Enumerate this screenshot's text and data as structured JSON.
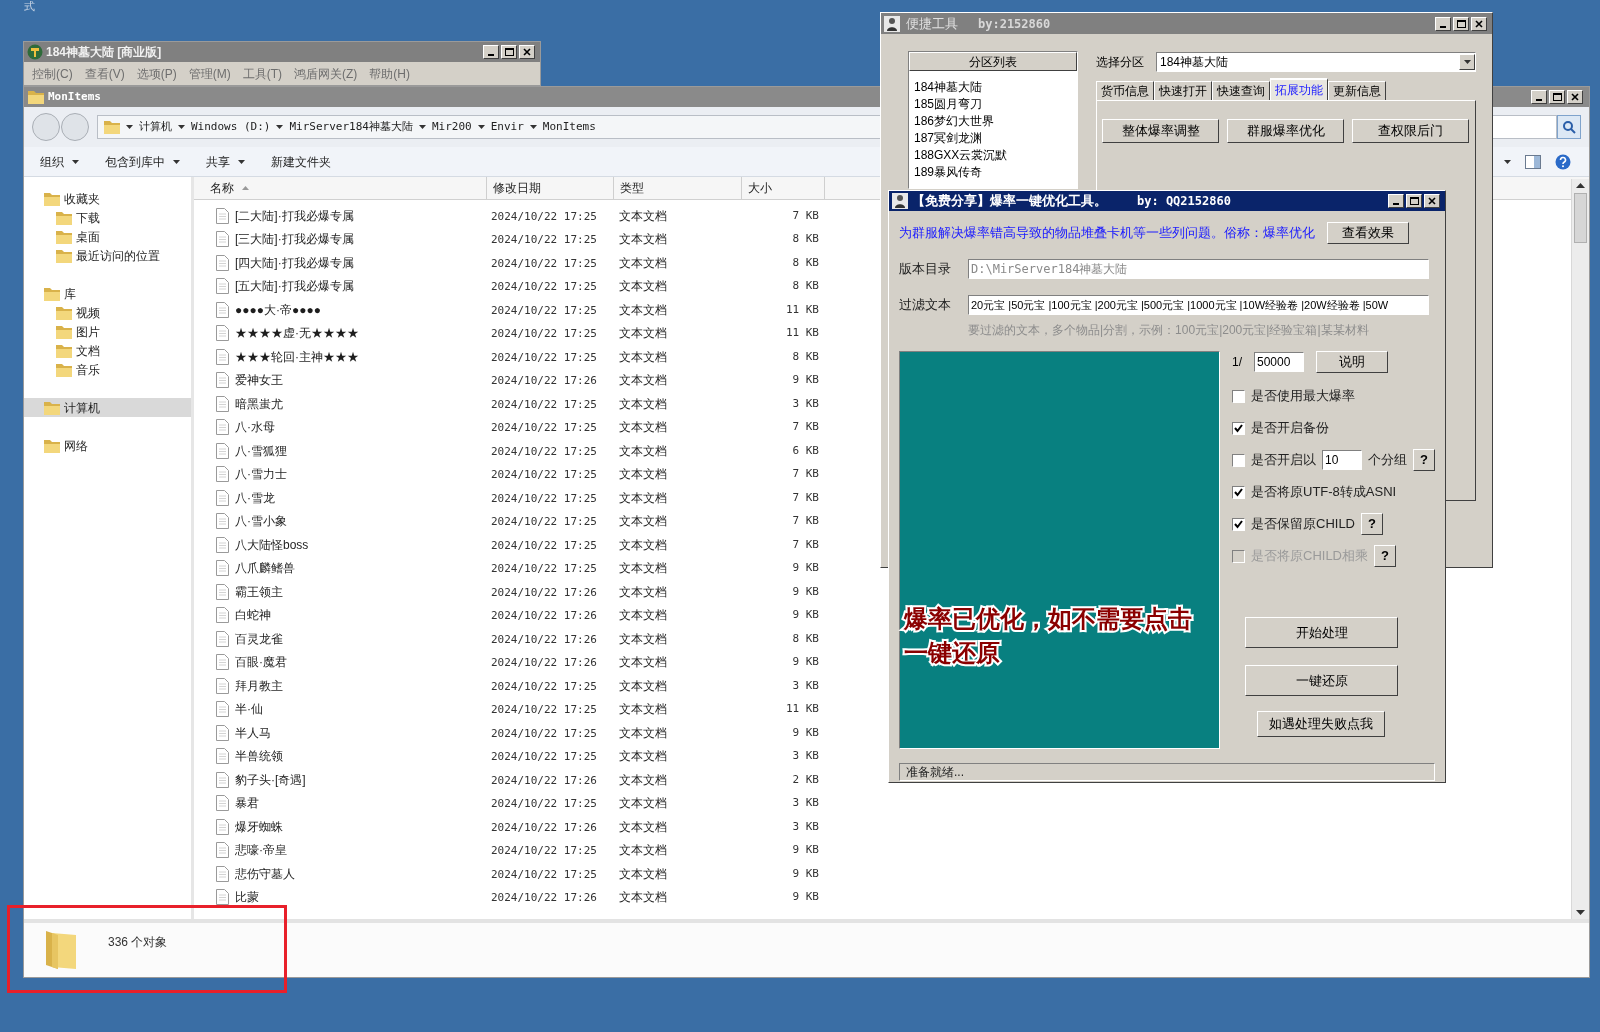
{
  "desktop": {
    "corner_text": "式"
  },
  "app_window": {
    "title": "184神墓大陆 [商业版]",
    "menu": [
      "控制(C)",
      "查看(V)",
      "选项(P)",
      "管理(M)",
      "工具(T)",
      "鸿盾网关(Z)",
      "帮助(H)"
    ]
  },
  "explorer": {
    "title": "MonItems",
    "breadcrumb": [
      "计算机",
      "Windows (D:)",
      "MirServer184神墓大陆",
      "Mir200",
      "Envir",
      "MonItems"
    ],
    "toolbar": [
      {
        "label": "组织",
        "dropdown": true
      },
      {
        "label": "包含到库中",
        "dropdown": true
      },
      {
        "label": "共享",
        "dropdown": true
      },
      {
        "label": "新建文件夹",
        "dropdown": false
      }
    ],
    "nav": [
      {
        "label": "收藏夹",
        "selected": false,
        "children": [
          {
            "label": "下载",
            "selected": false
          },
          {
            "label": "桌面",
            "selected": false
          },
          {
            "label": "最近访问的位置",
            "selected": false
          }
        ]
      },
      {
        "label": "库",
        "selected": false,
        "children": [
          {
            "label": "视频",
            "selected": false
          },
          {
            "label": "图片",
            "selected": false
          },
          {
            "label": "文档",
            "selected": false
          },
          {
            "label": "音乐",
            "selected": false
          }
        ]
      },
      {
        "label": "计算机",
        "selected": true
      },
      {
        "label": "网络",
        "selected": false
      }
    ],
    "columns": [
      "名称",
      "修改日期",
      "类型",
      "大小"
    ],
    "rows": [
      {
        "name": "[二大陆]·打我必爆专属",
        "date": "2024/10/22 17:25",
        "type": "文本文档",
        "size": "7 KB"
      },
      {
        "name": "[三大陆]·打我必爆专属",
        "date": "2024/10/22 17:25",
        "type": "文本文档",
        "size": "8 KB"
      },
      {
        "name": "[四大陆]·打我必爆专属",
        "date": "2024/10/22 17:25",
        "type": "文本文档",
        "size": "8 KB"
      },
      {
        "name": "[五大陆]·打我必爆专属",
        "date": "2024/10/22 17:25",
        "type": "文本文档",
        "size": "8 KB"
      },
      {
        "name": "●●●●大·帝●●●●",
        "date": "2024/10/22 17:25",
        "type": "文本文档",
        "size": "11 KB"
      },
      {
        "name": "★★★★虚·无★★★★",
        "date": "2024/10/22 17:25",
        "type": "文本文档",
        "size": "11 KB"
      },
      {
        "name": "★★★轮回·主神★★★",
        "date": "2024/10/22 17:25",
        "type": "文本文档",
        "size": "8 KB"
      },
      {
        "name": "爱神女王",
        "date": "2024/10/22 17:26",
        "type": "文本文档",
        "size": "9 KB"
      },
      {
        "name": "暗黑蚩尤",
        "date": "2024/10/22 17:25",
        "type": "文本文档",
        "size": "3 KB"
      },
      {
        "name": "八·水母",
        "date": "2024/10/22 17:25",
        "type": "文本文档",
        "size": "7 KB"
      },
      {
        "name": "八·雪狐狸",
        "date": "2024/10/22 17:25",
        "type": "文本文档",
        "size": "6 KB"
      },
      {
        "name": "八·雪力士",
        "date": "2024/10/22 17:25",
        "type": "文本文档",
        "size": "7 KB"
      },
      {
        "name": "八·雪龙",
        "date": "2024/10/22 17:25",
        "type": "文本文档",
        "size": "7 KB"
      },
      {
        "name": "八·雪小象",
        "date": "2024/10/22 17:25",
        "type": "文本文档",
        "size": "7 KB"
      },
      {
        "name": "八大陆怪boss",
        "date": "2024/10/22 17:25",
        "type": "文本文档",
        "size": "7 KB"
      },
      {
        "name": "八爪麟鳍兽",
        "date": "2024/10/22 17:25",
        "type": "文本文档",
        "size": "9 KB"
      },
      {
        "name": "霸王领主",
        "date": "2024/10/22 17:26",
        "type": "文本文档",
        "size": "9 KB"
      },
      {
        "name": "白蛇神",
        "date": "2024/10/22 17:26",
        "type": "文本文档",
        "size": "9 KB"
      },
      {
        "name": "百灵龙雀",
        "date": "2024/10/22 17:26",
        "type": "文本文档",
        "size": "8 KB"
      },
      {
        "name": "百眼·魔君",
        "date": "2024/10/22 17:26",
        "type": "文本文档",
        "size": "9 KB"
      },
      {
        "name": "拜月教主",
        "date": "2024/10/22 17:25",
        "type": "文本文档",
        "size": "3 KB"
      },
      {
        "name": "半·仙",
        "date": "2024/10/22 17:25",
        "type": "文本文档",
        "size": "11 KB"
      },
      {
        "name": "半人马",
        "date": "2024/10/22 17:25",
        "type": "文本文档",
        "size": "9 KB"
      },
      {
        "name": "半兽统领",
        "date": "2024/10/22 17:25",
        "type": "文本文档",
        "size": "3 KB"
      },
      {
        "name": "豹子头·[奇遇]",
        "date": "2024/10/22 17:26",
        "type": "文本文档",
        "size": "2 KB"
      },
      {
        "name": "暴君",
        "date": "2024/10/22 17:25",
        "type": "文本文档",
        "size": "3 KB"
      },
      {
        "name": "爆牙蜘蛛",
        "date": "2024/10/22 17:26",
        "type": "文本文档",
        "size": "3 KB"
      },
      {
        "name": "悲嚎·帝皇",
        "date": "2024/10/22 17:25",
        "type": "文本文档",
        "size": "9 KB"
      },
      {
        "name": "悲伤守墓人",
        "date": "2024/10/22 17:25",
        "type": "文本文档",
        "size": "9 KB"
      },
      {
        "name": "比蒙",
        "date": "2024/10/22 17:26",
        "type": "文本文档",
        "size": "9 KB"
      }
    ],
    "status": "336 个对象"
  },
  "tool_window": {
    "title": "便捷工具",
    "author": "by:2152860",
    "list_header": "分区列表",
    "servers": [
      "184神墓大陆",
      "185圆月弯刀",
      "186梦幻大世界",
      "187冥剑龙渊",
      "188GXX云裳沉默",
      "189暴风传奇"
    ],
    "select_label": "选择分区",
    "select_value": "184神墓大陆",
    "tabs": [
      {
        "label": "货币信息",
        "selected": false
      },
      {
        "label": "快速打开",
        "selected": false
      },
      {
        "label": "快速查询",
        "selected": false
      },
      {
        "label": "拓展功能",
        "selected": true
      },
      {
        "label": "更新信息",
        "selected": false
      }
    ],
    "buttons": [
      "整体爆率调整",
      "群服爆率优化",
      "查权限后门"
    ]
  },
  "optimizer": {
    "title": "【免费分享】爆率一键优化工具。",
    "author": "by: QQ2152860",
    "description": "为群服解决爆率错高导致的物品堆叠卡机等一些列问题。俗称：爆率优化",
    "view_button": "查看效果",
    "fields": [
      {
        "label": "版本目录",
        "value": "D:\\MirServer184神墓大陆",
        "disabled": true
      },
      {
        "label": "过滤文本",
        "value": "20元宝 |50元宝 |100元宝 |200元宝 |500元宝 |1000元宝 |10W经验卷 |20W经验卷 |50W",
        "disabled": false
      }
    ],
    "hint": "要过滤的文本，多个物品|分割，示例：100元宝|200元宝|经验宝箱|某某材料",
    "message": "爆率已优化，如不需要点击一键还原",
    "ratio_label": "1/",
    "ratio_value": "50000",
    "explain_button": "说明",
    "options": [
      {
        "label": "是否使用最大爆率",
        "checked": false,
        "disabled": false
      },
      {
        "label": "是否开启备份",
        "checked": true,
        "disabled": false
      },
      {
        "label": "是否开启以",
        "checked": false,
        "disabled": false,
        "input": "10",
        "suffix": "个分组",
        "help": "?"
      },
      {
        "label": "是否将原UTF-8转成ASNI",
        "checked": true,
        "disabled": false
      },
      {
        "label": "是否保留原CHILD",
        "checked": true,
        "disabled": false,
        "help": "?"
      },
      {
        "label": "是否将原CHILD相乘",
        "checked": false,
        "disabled": true,
        "help": "?"
      }
    ],
    "actions": [
      {
        "label": "开始处理",
        "kind": "large"
      },
      {
        "label": "一键还原",
        "kind": "large"
      },
      {
        "label": "如遇处理失败点我",
        "kind": "small"
      }
    ],
    "status": "准备就绪..."
  }
}
